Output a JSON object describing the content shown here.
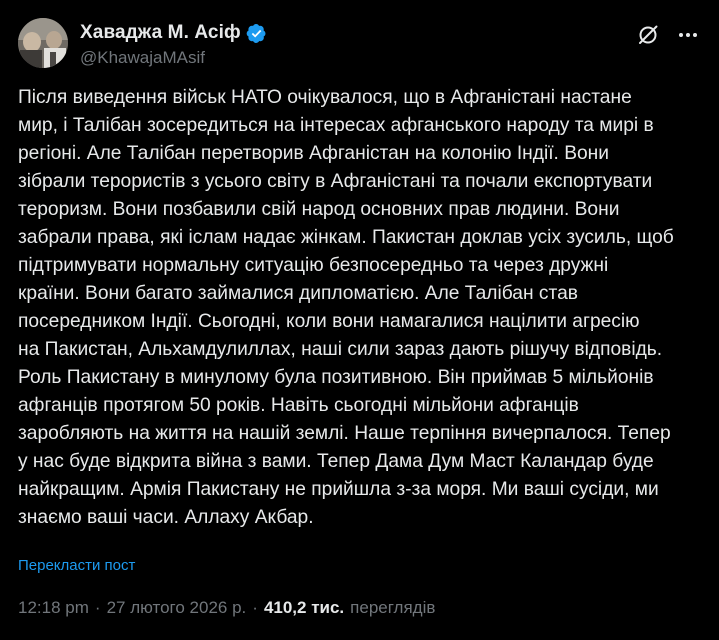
{
  "author": {
    "display_name": "Хаваджа М. Асіф",
    "handle": "@KhawajaMAsif",
    "verified_color": "#1d9bf0"
  },
  "post": {
    "lines": [
      "Після виведення військ НАТО очікувалося, що в Афганістані настане",
      "мир, і Талібан зосередиться на інтересах афганського народу та мирі в",
      "регіоні. Але Талібан перетворив Афганістан на колонію Індії. Вони",
      "зібрали терористів з усього світу в Афганістані та почали експортувати",
      "тероризм. Вони позбавили свій народ основних прав людини. Вони",
      "забрали права, які іслам надає жінкам. Пакистан доклав усіх зусиль, щоб",
      "підтримувати нормальну ситуацію безпосередньо та через дружні",
      "країни. Вони багато займалися дипломатією. Але Талібан став",
      "посередником Індії. Сьогодні, коли вони намагалися націлити агресію",
      "на Пакистан, Альхамдулиллах, наші сили зараз дають рішучу відповідь.",
      "Роль Пакистану в минулому була позитивною. Він приймав 5 мільйонів",
      "афганців протягом 50 років. Навіть сьогодні мільйони афганців",
      "заробляють на життя на нашій землі. Наше терпіння вичерпалося. Тепер",
      "у нас буде відкрита війна з вами. Тепер Дама Дум Маст Каландар буде",
      "найкращим. Армія Пакистану не прийшла з-за моря. Ми ваші сусіди, ми",
      "знаємо ваші часи. Аллаху Акбар."
    ],
    "translate_label": "Перекласти пост"
  },
  "meta": {
    "time": "12:18 pm",
    "date": "27 лютого 2026 р.",
    "views_count": "410,2 тис.",
    "views_label": "переглядів",
    "separator": "·"
  },
  "icons": {
    "grok": "grok-icon",
    "more": "more-options-icon"
  }
}
